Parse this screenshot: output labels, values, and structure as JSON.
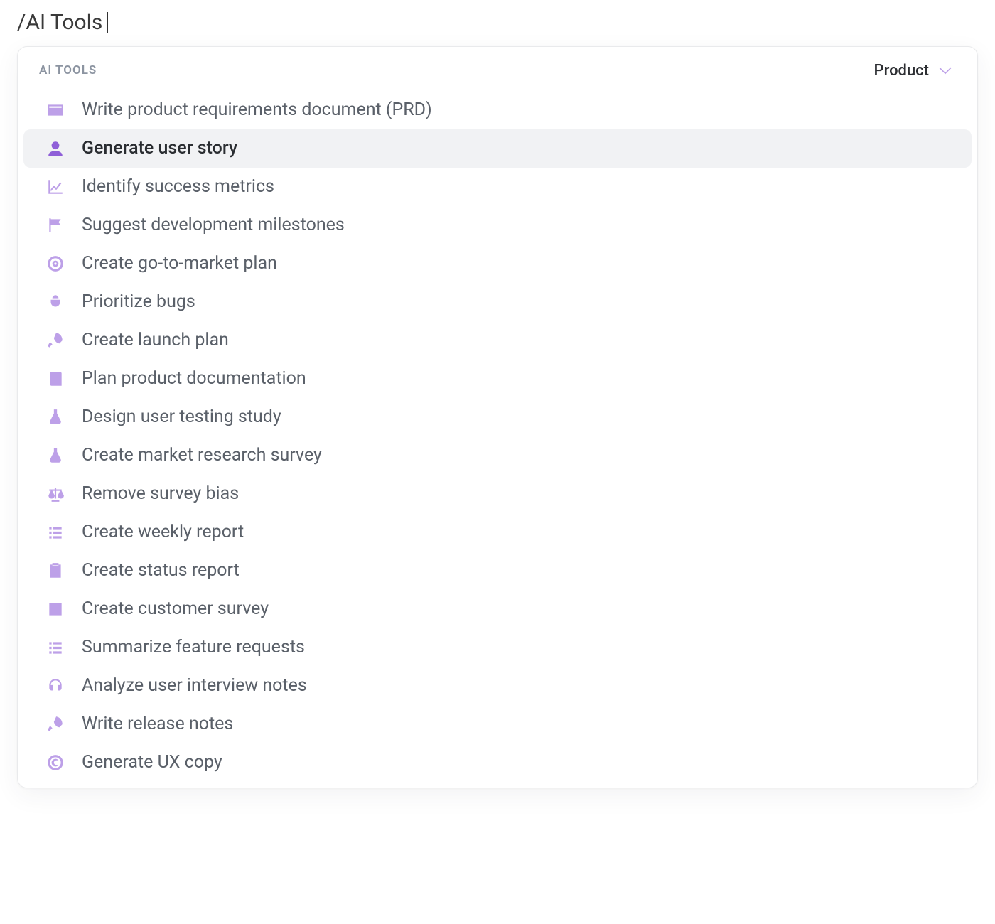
{
  "input": {
    "text": "/AI Tools"
  },
  "panel": {
    "section_label": "AI TOOLS",
    "filter_label": "Product"
  },
  "items": [
    {
      "icon": "id-card-icon",
      "label": "Write product requirements document (PRD)",
      "selected": false
    },
    {
      "icon": "user-icon",
      "label": "Generate user story",
      "selected": true
    },
    {
      "icon": "chart-line-icon",
      "label": "Identify success metrics",
      "selected": false
    },
    {
      "icon": "flag-icon",
      "label": "Suggest development milestones",
      "selected": false
    },
    {
      "icon": "target-icon",
      "label": "Create go-to-market plan",
      "selected": false
    },
    {
      "icon": "bug-icon",
      "label": "Prioritize bugs",
      "selected": false
    },
    {
      "icon": "rocket-icon",
      "label": "Create launch plan",
      "selected": false
    },
    {
      "icon": "book-icon",
      "label": "Plan product documentation",
      "selected": false
    },
    {
      "icon": "flask-icon",
      "label": "Design user testing study",
      "selected": false
    },
    {
      "icon": "flask-icon",
      "label": "Create market research survey",
      "selected": false
    },
    {
      "icon": "balance-icon",
      "label": "Remove survey bias",
      "selected": false
    },
    {
      "icon": "list-icon",
      "label": "Create weekly report",
      "selected": false
    },
    {
      "icon": "clipboard-icon",
      "label": "Create status report",
      "selected": false
    },
    {
      "icon": "bar-chart-icon",
      "label": "Create customer survey",
      "selected": false
    },
    {
      "icon": "list-icon",
      "label": "Summarize feature requests",
      "selected": false
    },
    {
      "icon": "headset-icon",
      "label": "Analyze user interview notes",
      "selected": false
    },
    {
      "icon": "rocket-icon",
      "label": "Write release notes",
      "selected": false
    },
    {
      "icon": "copyright-icon",
      "label": "Generate UX copy",
      "selected": false
    }
  ]
}
